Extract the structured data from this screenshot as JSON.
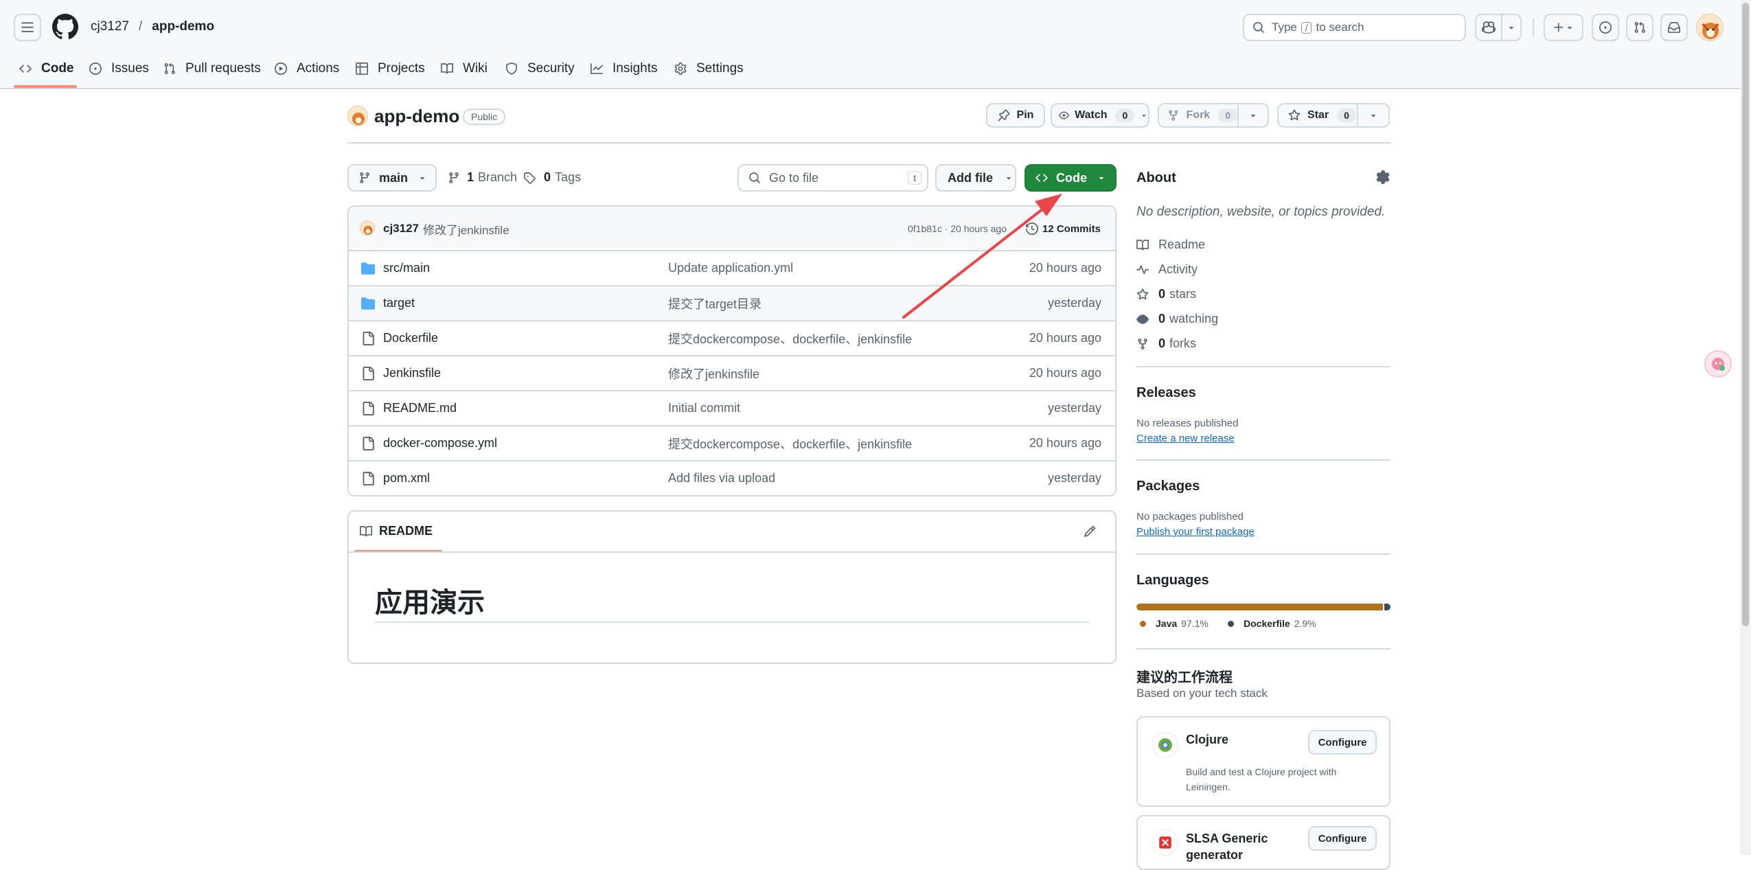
{
  "header": {
    "owner": "cj3127",
    "separator": "/",
    "repo": "app-demo",
    "search": {
      "prefix": "Type",
      "key": "/",
      "suffix": "to search"
    }
  },
  "nav": {
    "tabs": [
      {
        "label": "Code",
        "icon": "code-icon"
      },
      {
        "label": "Issues",
        "icon": "issue-icon"
      },
      {
        "label": "Pull requests",
        "icon": "pull-request-icon"
      },
      {
        "label": "Actions",
        "icon": "play-icon"
      },
      {
        "label": "Projects",
        "icon": "table-icon"
      },
      {
        "label": "Wiki",
        "icon": "book-icon"
      },
      {
        "label": "Security",
        "icon": "shield-icon"
      },
      {
        "label": "Insights",
        "icon": "graph-icon"
      },
      {
        "label": "Settings",
        "icon": "gear-icon"
      }
    ]
  },
  "repo": {
    "name": "app-demo",
    "visibility": "Public",
    "actions": {
      "pin": "Pin",
      "watch": "Watch",
      "watch_count": "0",
      "fork": "Fork",
      "fork_count": "0",
      "star": "Star",
      "star_count": "0"
    }
  },
  "toolbar": {
    "branch": "main",
    "branch_count": "1",
    "branch_label": "Branch",
    "tag_count": "0",
    "tag_label": "Tags",
    "goto_placeholder": "Go to file",
    "goto_key": "t",
    "add_file": "Add file",
    "code": "Code"
  },
  "commit": {
    "author": "cj3127",
    "message": "修改了jenkinsfile",
    "meta": "0f1b81c · 20 hours ago",
    "count_label": "12 Commits"
  },
  "files": [
    {
      "name": "src/main",
      "type": "dir",
      "message": "Update application.yml",
      "time": "20 hours ago"
    },
    {
      "name": "target",
      "type": "dir",
      "message": "提交了target目录",
      "time": "yesterday"
    },
    {
      "name": "Dockerfile",
      "type": "file",
      "message": "提交dockercompose、dockerfile、jenkinsfile",
      "time": "20 hours ago"
    },
    {
      "name": "Jenkinsfile",
      "type": "file",
      "message": "修改了jenkinsfile",
      "time": "20 hours ago"
    },
    {
      "name": "README.md",
      "type": "file",
      "message": "Initial commit",
      "time": "yesterday"
    },
    {
      "name": "docker-compose.yml",
      "type": "file",
      "message": "提交dockercompose、dockerfile、jenkinsfile",
      "time": "20 hours ago"
    },
    {
      "name": "pom.xml",
      "type": "file",
      "message": "Add files via upload",
      "time": "yesterday"
    }
  ],
  "readme": {
    "tab": "README",
    "heading": "应用演示"
  },
  "about": {
    "title": "About",
    "description": "No description, website, or topics provided.",
    "readme": "Readme",
    "activity": "Activity",
    "stars_count": "0",
    "stars_label": "stars",
    "watching_count": "0",
    "watching_label": "watching",
    "forks_count": "0",
    "forks_label": "forks"
  },
  "releases": {
    "title": "Releases",
    "empty": "No releases published",
    "link": "Create a new release"
  },
  "packages": {
    "title": "Packages",
    "empty": "No packages published",
    "link": "Publish your first package"
  },
  "languages": {
    "title": "Languages",
    "items": [
      {
        "name": "Java",
        "percent": "97.1%",
        "value": 97.1,
        "color": "#b07219"
      },
      {
        "name": "Dockerfile",
        "percent": "2.9%",
        "value": 2.9,
        "color": "#384d54"
      }
    ]
  },
  "workflows": {
    "title": "建议的工作流程",
    "subtitle": "Based on your tech stack",
    "items": [
      {
        "name": "Clojure",
        "button": "Configure",
        "description": "Build and test a Clojure project with Leiningen."
      },
      {
        "name": "SLSA Generic generator",
        "button": "Configure"
      }
    ]
  },
  "colors": {
    "accent_green": "#1f883d",
    "link_blue": "#0969da",
    "annotation_arrow": "#e8484a",
    "folder_blue": "#54aeff"
  }
}
